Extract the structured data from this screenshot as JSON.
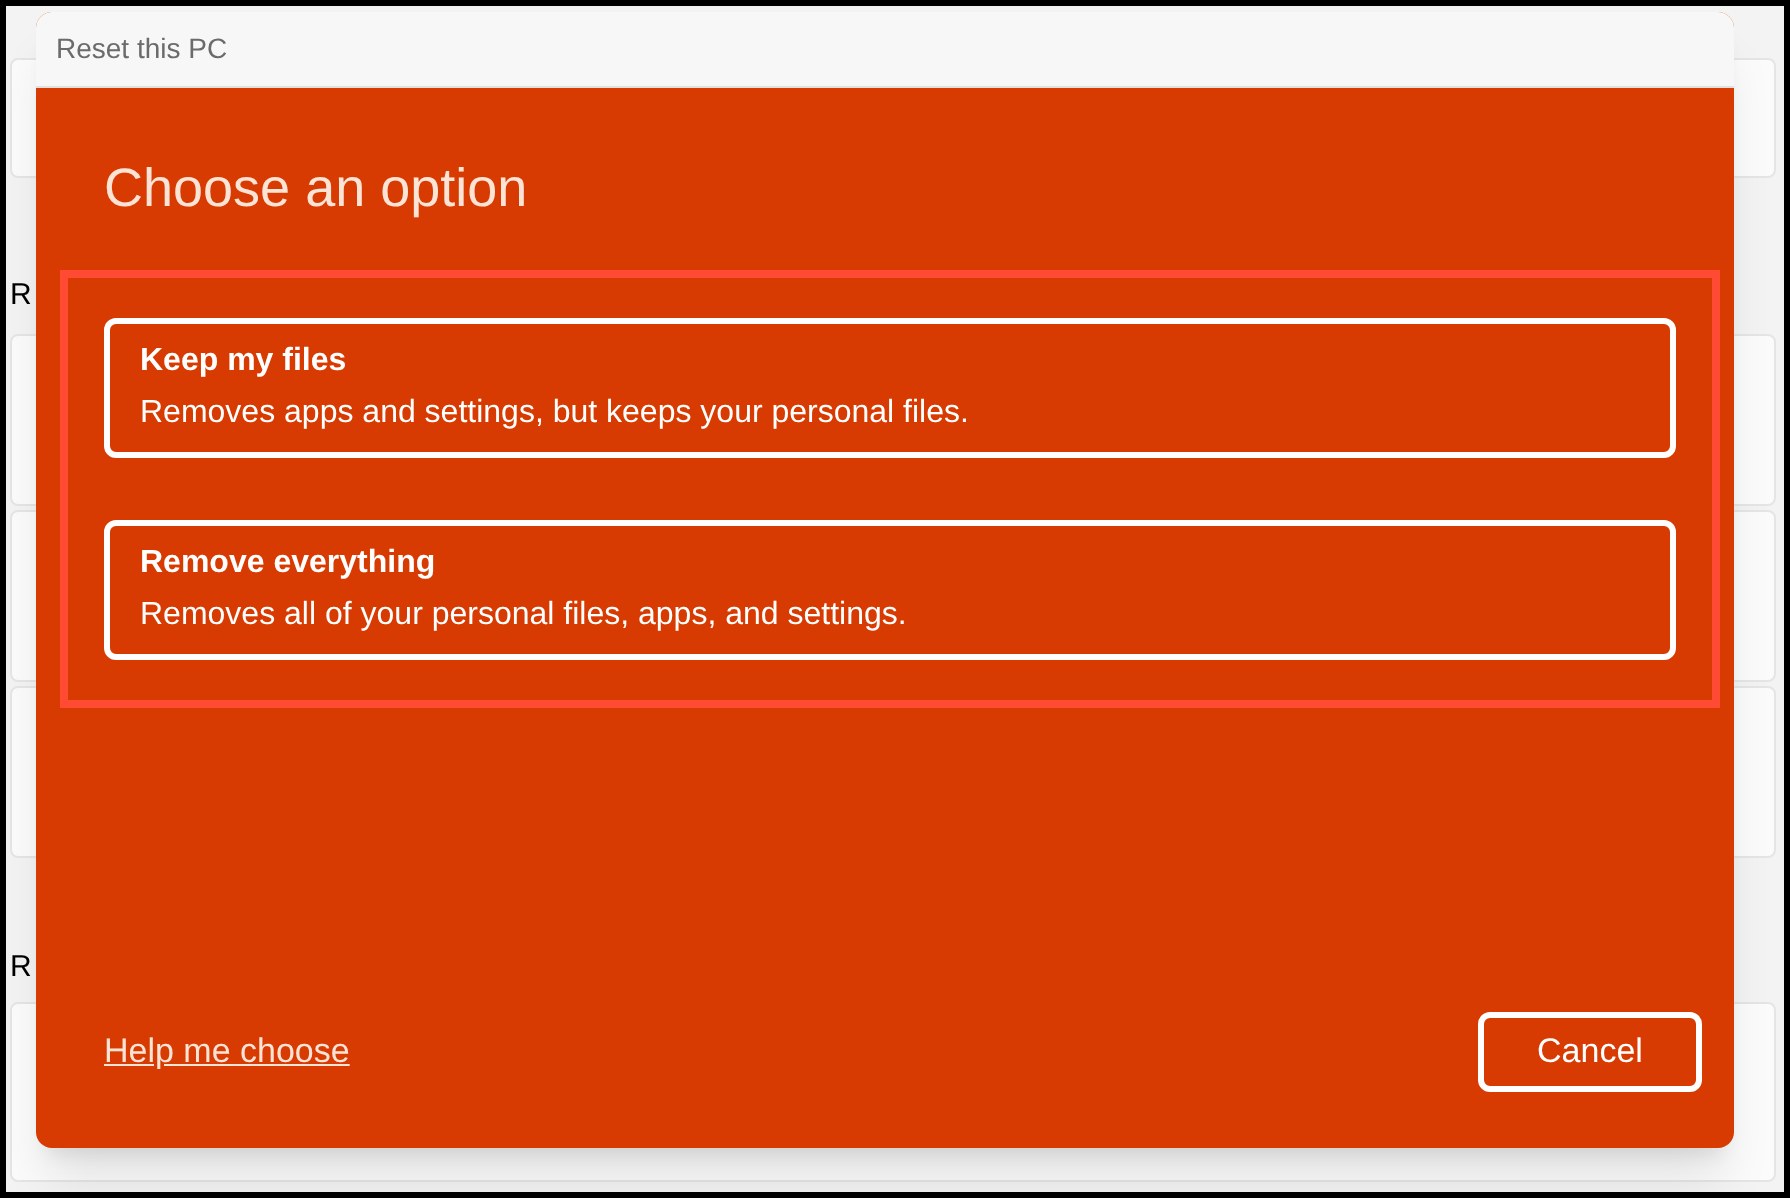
{
  "background": {
    "section_labels": [
      "R",
      "R"
    ]
  },
  "dialog": {
    "title": "Reset this PC",
    "heading": "Choose an option",
    "options": [
      {
        "title": "Keep my files",
        "description": "Removes apps and settings, but keeps your personal files."
      },
      {
        "title": "Remove everything",
        "description": "Removes all of your personal files, apps, and settings."
      }
    ],
    "help_link": "Help me choose",
    "cancel_button": "Cancel"
  }
}
